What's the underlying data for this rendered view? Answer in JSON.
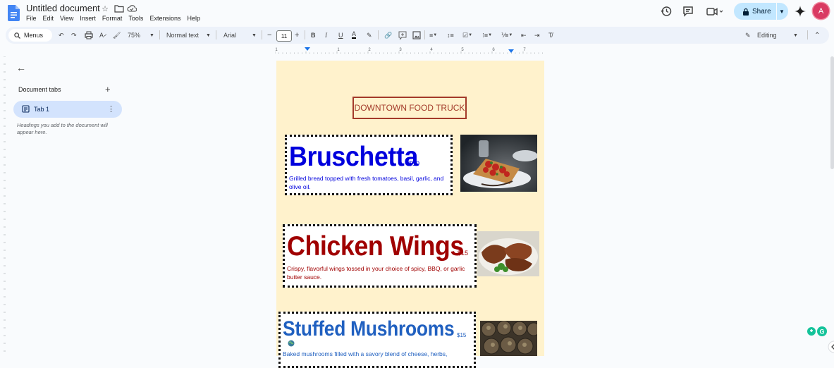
{
  "app": {
    "title": "Untitled document",
    "menu": [
      "File",
      "Edit",
      "View",
      "Insert",
      "Format",
      "Tools",
      "Extensions",
      "Help"
    ],
    "share_label": "Share",
    "avatar_letter": "A",
    "colors": {
      "share_bg": "#c2e7ff",
      "tab_active_bg": "#d3e3fd",
      "avatar": "#d93a62",
      "page_bg": "#fff2cc"
    }
  },
  "toolbar": {
    "menus_label": "Menus",
    "zoom": "75%",
    "style": "Normal text",
    "font": "Arial",
    "font_size": "11",
    "mode": "Editing"
  },
  "sidebar": {
    "title": "Document tabs",
    "tab_label": "Tab 1",
    "hint": "Headings you add to the document will appear here."
  },
  "document": {
    "banner": "DOWNTOWN FOOD TRUCK",
    "items": [
      {
        "name": "Bruschetta",
        "price": "$10",
        "description": "Grilled bread topped with fresh tomatoes, basil, garlic, and olive oil.",
        "color": "#0000dd"
      },
      {
        "name": "Chicken Wings",
        "price": "$15",
        "description": "Crispy, flavorful wings tossed in your choice of spicy, BBQ, or garlic butter sauce.",
        "color": "#a00000"
      },
      {
        "name": "Stuffed Mushrooms",
        "price": "$15",
        "description": "Baked mushrooms filled with a savory blend of cheese, herbs,",
        "color": "#2060c0"
      }
    ]
  },
  "ruler_numbers": [
    "1",
    "1",
    "2",
    "3",
    "4",
    "5",
    "6",
    "7"
  ]
}
